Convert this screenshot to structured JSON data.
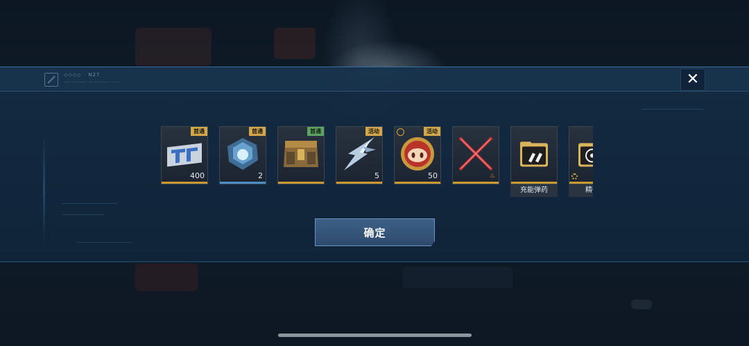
{
  "header": {
    "code_text": "◇◇◇◇ · N27",
    "sub_text": "─── ────── ── ───── ─ ── ─",
    "close_symbol": "✕"
  },
  "rewards": [
    {
      "name": "",
      "badge": "首通",
      "badge_color": "gold",
      "quantity": "400",
      "icon": "ticket-card-icon",
      "bar": "gold"
    },
    {
      "name": "",
      "badge": "首通",
      "badge_color": "gold",
      "quantity": "2",
      "icon": "crystal-core-icon",
      "bar": "blue"
    },
    {
      "name": "",
      "badge": "首通",
      "badge_color": "green",
      "quantity": "",
      "icon": "supply-crate-icon",
      "bar": "gold"
    },
    {
      "name": "",
      "badge": "活动",
      "badge_color": "gold",
      "quantity": "5",
      "icon": "ice-shard-icon",
      "bar": "gold"
    },
    {
      "name": "",
      "badge": "活动",
      "badge_color": "gold",
      "quantity": "50",
      "icon": "pig-coin-icon",
      "bar": "gold"
    },
    {
      "name": "",
      "badge": "",
      "badge_color": "",
      "quantity": "",
      "icon": "crossed-blades-icon",
      "bar": "gold"
    },
    {
      "name": "充能弹药",
      "badge": "",
      "badge_color": "",
      "quantity": "",
      "icon": "ammo-icon",
      "bar": "gold"
    },
    {
      "name": "精确",
      "badge": "",
      "badge_color": "",
      "quantity": "",
      "icon": "target-skull-icon",
      "bar": "gold"
    }
  ],
  "confirm_label": "确定",
  "colors": {
    "gold": "#c99a2e",
    "blue": "#4d8ec6",
    "green_badge": "#5fa064",
    "button": "#3d5f86"
  }
}
